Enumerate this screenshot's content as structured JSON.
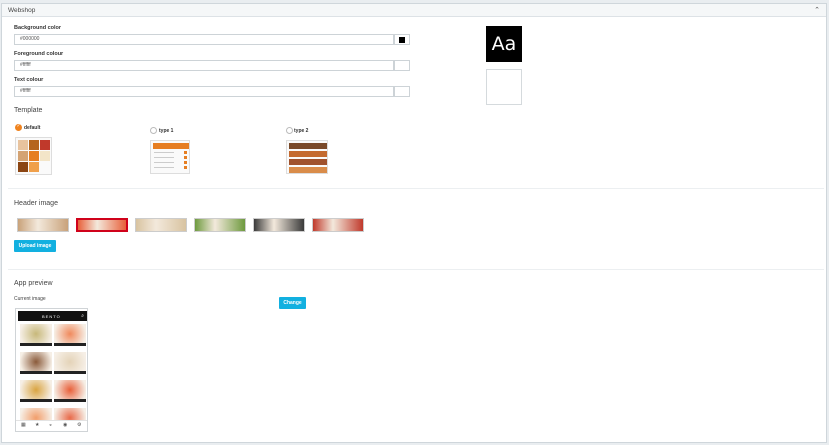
{
  "panel": {
    "title": "Webshop",
    "collapse_icon": "caret-up-icon"
  },
  "colors": {
    "background": {
      "label": "Background color",
      "value": "#000000",
      "swatch": "#000000"
    },
    "foreground": {
      "label": "Foreground colour",
      "value": "#ffffff",
      "swatch": "#ffffff"
    },
    "text": {
      "label": "Text colour",
      "value": "#ffffff",
      "swatch": "#ffffff"
    },
    "preview_text": "Aa"
  },
  "template": {
    "title": "Template",
    "options": [
      {
        "label": "default",
        "selected": true
      },
      {
        "label": "type 1",
        "selected": false
      },
      {
        "label": "type 2",
        "selected": false
      }
    ]
  },
  "header_image": {
    "title": "Header image",
    "upload_label": "Upload image",
    "selected_index": 1,
    "thumb_colors": [
      "#c9a27a",
      "#e8603a",
      "#d8c3a0",
      "#6e9a3e",
      "#3a3a3a",
      "#c0392b"
    ]
  },
  "app_preview": {
    "title": "App preview",
    "current_label": "Current image",
    "change_label": "Change",
    "logo_text": "BENTO",
    "food_colors": [
      "#c7b87a",
      "#f08a5d",
      "#8a5a3a",
      "#e4d3b8",
      "#d9a441",
      "#e8603a",
      "#f29e6b",
      "#e86a4a"
    ]
  }
}
